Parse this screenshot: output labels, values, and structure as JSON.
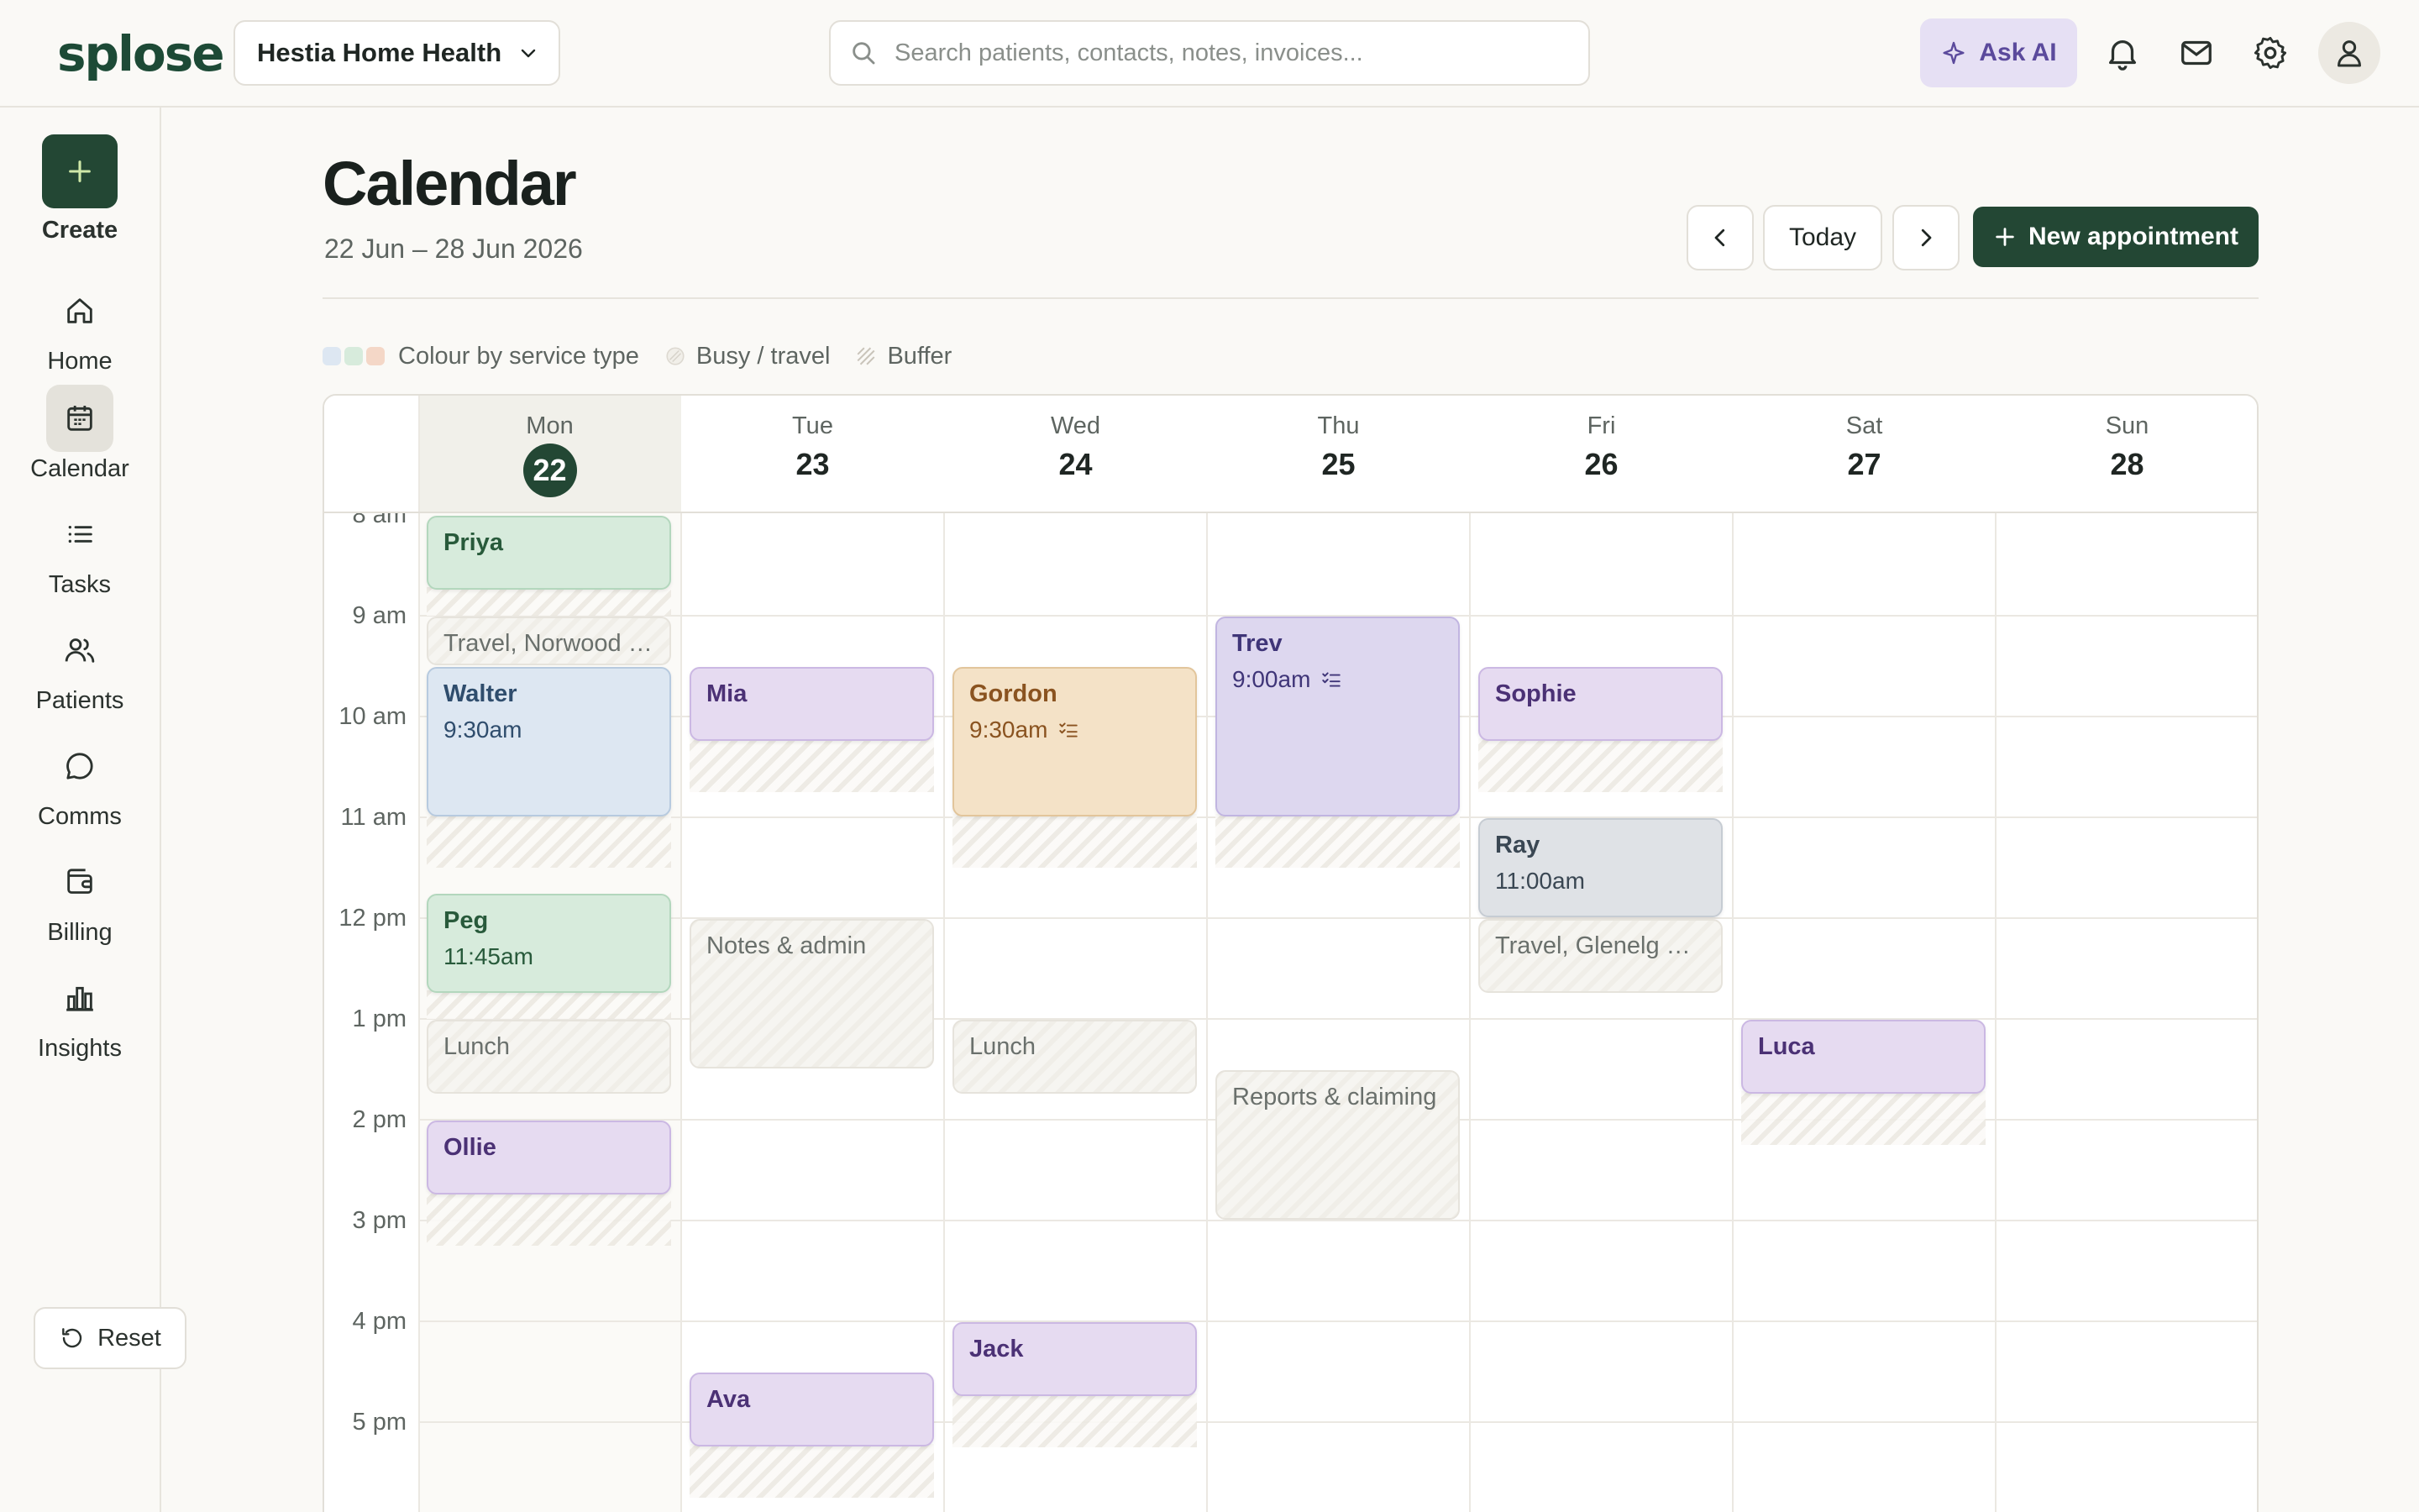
{
  "app": {
    "logo": "splose",
    "organisation": "Hestia Home Health",
    "search_placeholder": "Search patients, contacts, notes, invoices...",
    "ask_ai": "Ask AI"
  },
  "sidebar": {
    "create_label": "Create",
    "items": [
      {
        "label": "Home",
        "icon": "home-icon",
        "active": false
      },
      {
        "label": "Calendar",
        "icon": "calendar-icon",
        "active": true
      },
      {
        "label": "Tasks",
        "icon": "list-icon",
        "active": false
      },
      {
        "label": "Patients",
        "icon": "users-icon",
        "active": false
      },
      {
        "label": "Comms",
        "icon": "chat-icon",
        "active": false
      },
      {
        "label": "Billing",
        "icon": "wallet-icon",
        "active": false
      },
      {
        "label": "Insights",
        "icon": "bar-chart-icon",
        "active": false
      }
    ],
    "reset_label": "Reset"
  },
  "header": {
    "title": "Calendar",
    "date_range": "22 Jun – 28 Jun 2026",
    "today_label": "Today",
    "new_appointment_label": "New appointment"
  },
  "legend": {
    "colour_by": "Colour by service type",
    "busy": "Busy / travel",
    "buffer": "Buffer",
    "swatch_colors": [
      "#dde7f2",
      "#d7ebdc",
      "#f4d7c7"
    ]
  },
  "calendar": {
    "days": [
      {
        "name": "Mon",
        "date": "22",
        "today": true
      },
      {
        "name": "Tue",
        "date": "23",
        "today": false
      },
      {
        "name": "Wed",
        "date": "24",
        "today": false
      },
      {
        "name": "Thu",
        "date": "25",
        "today": false
      },
      {
        "name": "Fri",
        "date": "26",
        "today": false
      },
      {
        "name": "Sat",
        "date": "27",
        "today": false
      },
      {
        "name": "Sun",
        "date": "28",
        "today": false
      }
    ],
    "hours": [
      "8 am",
      "9 am",
      "10 am",
      "11 am",
      "12 pm",
      "1 pm",
      "2 pm",
      "3 pm",
      "4 pm",
      "5 pm"
    ],
    "events": [
      {
        "day": 0,
        "start": 8.0,
        "end": 8.75,
        "title": "Priya",
        "time": "",
        "style": "green",
        "buffer_until": 9.0
      },
      {
        "day": 0,
        "start": 9.0,
        "end": 9.5,
        "title": "Travel, Norwood → Walter",
        "time": "",
        "style": "busy"
      },
      {
        "day": 0,
        "start": 9.5,
        "end": 11.0,
        "title": "Walter",
        "time": "9:30am",
        "style": "blue",
        "buffer_until": 11.5
      },
      {
        "day": 0,
        "start": 11.75,
        "end": 12.75,
        "title": "Peg",
        "time": "11:45am",
        "style": "green",
        "buffer_until": 13.0
      },
      {
        "day": 0,
        "start": 13.0,
        "end": 13.75,
        "title": "Lunch",
        "time": "",
        "style": "busy"
      },
      {
        "day": 0,
        "start": 14.0,
        "end": 14.75,
        "title": "Ollie",
        "time": "",
        "style": "purple",
        "buffer_until": 15.25
      },
      {
        "day": 1,
        "start": 9.5,
        "end": 10.25,
        "title": "Mia",
        "time": "",
        "style": "purple",
        "buffer_until": 10.75
      },
      {
        "day": 1,
        "start": 12.0,
        "end": 13.5,
        "title": "Notes & admin",
        "time": "",
        "style": "busy"
      },
      {
        "day": 1,
        "start": 16.5,
        "end": 17.25,
        "title": "Ava",
        "time": "",
        "style": "purple",
        "buffer_until": 17.75
      },
      {
        "day": 2,
        "start": 9.5,
        "end": 11.0,
        "title": "Gordon",
        "time": "9:30am",
        "style": "orange",
        "checklist": true,
        "buffer_until": 11.5
      },
      {
        "day": 2,
        "start": 13.0,
        "end": 13.75,
        "title": "Lunch",
        "time": "",
        "style": "busy"
      },
      {
        "day": 2,
        "start": 16.0,
        "end": 16.75,
        "title": "Jack",
        "time": "",
        "style": "purple",
        "buffer_until": 17.25
      },
      {
        "day": 3,
        "start": 9.0,
        "end": 11.0,
        "title": "Trev",
        "time": "9:00am",
        "style": "violet",
        "checklist": true,
        "buffer_until": 11.5
      },
      {
        "day": 3,
        "start": 13.5,
        "end": 15.0,
        "title": "Reports & claiming",
        "time": "",
        "style": "busy"
      },
      {
        "day": 4,
        "start": 9.5,
        "end": 10.25,
        "title": "Sophie",
        "time": "",
        "style": "purple",
        "buffer_until": 10.75
      },
      {
        "day": 4,
        "start": 11.0,
        "end": 12.0,
        "title": "Ray",
        "time": "11:00am",
        "style": "slate"
      },
      {
        "day": 4,
        "start": 12.0,
        "end": 12.75,
        "title": "Travel, Glenelg → Walter",
        "time": "",
        "style": "busy"
      },
      {
        "day": 5,
        "start": 13.0,
        "end": 13.75,
        "title": "Luca",
        "time": "",
        "style": "purple",
        "buffer_until": 14.25
      }
    ]
  }
}
